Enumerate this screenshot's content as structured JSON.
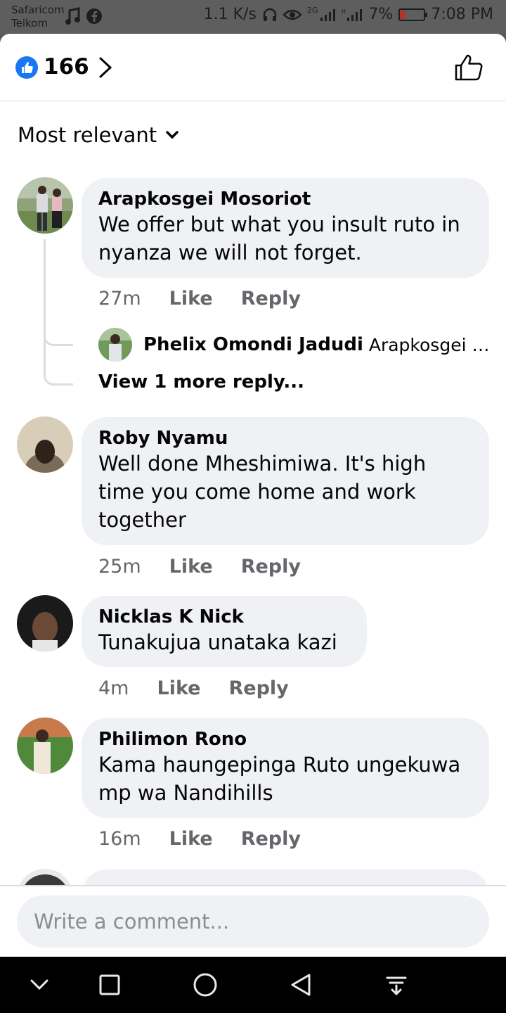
{
  "status_bar": {
    "carrier_1": "Safaricom",
    "carrier_2": "Telkom",
    "net_speed": "1.1 K/s",
    "network_label": "2G",
    "battery": "7%",
    "time": "7:08 PM"
  },
  "reactions": {
    "count": "166"
  },
  "sort": {
    "label": "Most relevant"
  },
  "comments": [
    {
      "name": "Arapkosgei Mosoriot",
      "lines": [
        "We offer but what you insult ruto in",
        "nyanza we will not forget."
      ],
      "time": "27m",
      "like_label": "Like",
      "reply_label": "Reply",
      "reply_preview": {
        "name": "Phelix Omondi Jadudi",
        "snippet": "Arapkosgei M..."
      },
      "view_more": "View 1 more reply..."
    },
    {
      "name": "Roby Nyamu",
      "lines": [
        "Well done Mheshimiwa. It's high",
        "time you come home and work",
        "together"
      ],
      "time": "25m",
      "like_label": "Like",
      "reply_label": "Reply"
    },
    {
      "name": "Nicklas K Nick",
      "lines": [
        "Tunakujua unataka kazi"
      ],
      "time": "4m",
      "like_label": "Like",
      "reply_label": "Reply"
    },
    {
      "name": "Philimon Rono",
      "lines": [
        "Kama haungepinga Ruto ungekuwa",
        "mp wa Nandihills"
      ],
      "time": "16m",
      "like_label": "Like",
      "reply_label": "Reply"
    }
  ],
  "composer": {
    "placeholder": "Write a comment..."
  },
  "icons": {
    "like_badge": "thumbs-up-icon",
    "header_like": "thumbs-up-outline-icon",
    "sort_chevron": "chevron-down-icon",
    "header_chevron": "chevron-right-icon",
    "nav": [
      "chevron-down-icon",
      "square-icon",
      "circle-icon",
      "triangle-back-icon",
      "notification-drawer-icon"
    ]
  },
  "colors": {
    "brand_blue": "#1877f2",
    "bubble_bg": "#eff1f4",
    "meta_gray": "#65676b"
  }
}
